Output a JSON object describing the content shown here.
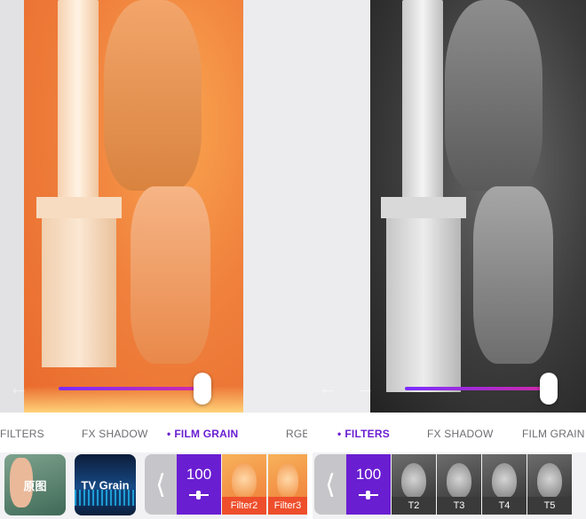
{
  "left_panel": {
    "tabs": [
      {
        "label": "FILTERS",
        "active": false
      },
      {
        "label": "FX SHADOW",
        "active": false
      },
      {
        "label": "FILM GRAIN",
        "active": true
      },
      {
        "label": "RGE",
        "active": false
      }
    ],
    "slider_level": 1.0,
    "thumbnails": [
      {
        "label": "原图"
      },
      {
        "label": "TV Grain"
      }
    ],
    "back_icon": "chevron-left-icon",
    "value": "100",
    "filters": [
      "Filter2",
      "Filter3"
    ]
  },
  "right_panel": {
    "tabs": [
      {
        "label": "FILTERS",
        "active": true
      },
      {
        "label": "FX SHADOW",
        "active": false
      },
      {
        "label": "FILM GRAIN",
        "active": false
      }
    ],
    "slider_level": 1.0,
    "back_icon": "chevron-left-icon",
    "value": "100",
    "filters": [
      "T2",
      "T3",
      "T4",
      "T5"
    ]
  },
  "colors": {
    "accent": "#6a1ed1",
    "slider_start": "#7a2cff",
    "slider_end": "#d02aa8",
    "filter_caption_orange": "#ee4e2b"
  }
}
